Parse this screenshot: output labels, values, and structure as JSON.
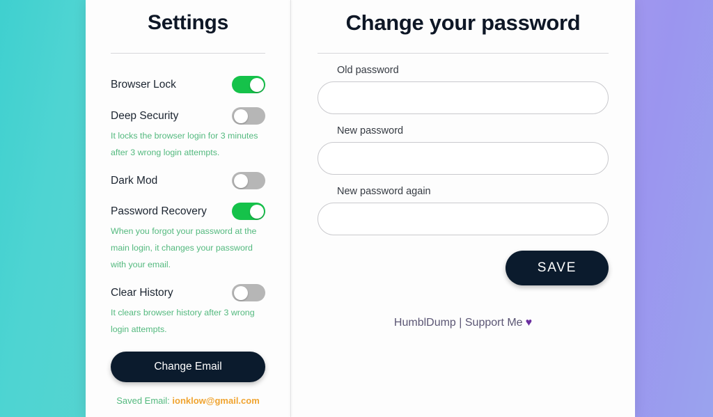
{
  "theme": {
    "gradient_left": "#3fd0cf",
    "gradient_right": "#9aa3ee",
    "card_bg": "#fdfdfd",
    "toggle_on": "#15c24a",
    "toggle_off": "#b6b6b6",
    "button_dark": "#0b1b2d",
    "desc_green": "#53b97e",
    "email_orange": "#f0a430",
    "heart_purple": "#6b2fa0"
  },
  "settings": {
    "title": "Settings",
    "items": [
      {
        "label": "Browser Lock",
        "state": "on",
        "description": ""
      },
      {
        "label": "Deep Security",
        "state": "off",
        "description": "It locks the browser login for 3 minutes after 3 wrong login attempts."
      },
      {
        "label": "Dark Mod",
        "state": "off",
        "description": ""
      },
      {
        "label": "Password Recovery",
        "state": "on",
        "description": "When you forgot your password at the main login, it changes your password with your email."
      },
      {
        "label": "Clear History",
        "state": "off",
        "description": "It clears browser history after 3 wrong login attempts."
      }
    ],
    "change_email_label": "Change Email",
    "saved_email_prefix": "Saved Email: ",
    "saved_email_value": "ionklow@gmail.com"
  },
  "password": {
    "title": "Change your password",
    "fields": [
      {
        "label": "Old password",
        "value": "",
        "placeholder": ""
      },
      {
        "label": "New password",
        "value": "",
        "placeholder": ""
      },
      {
        "label": "New password again",
        "value": "",
        "placeholder": ""
      }
    ],
    "save_label": "SAVE",
    "footer_text": "HumblDump | Support Me",
    "footer_heart": "♥"
  }
}
